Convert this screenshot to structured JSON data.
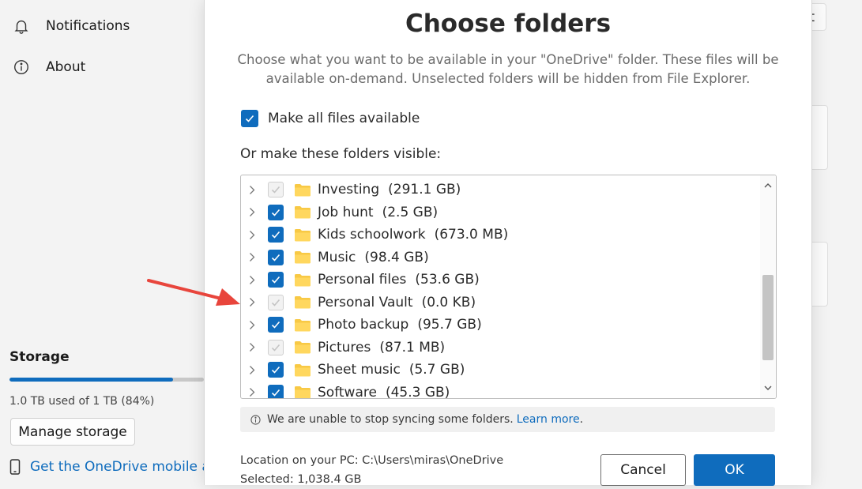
{
  "sidebar": {
    "items": [
      {
        "label": "Notifications",
        "icon": "bell-icon"
      },
      {
        "label": "About",
        "icon": "info-icon"
      }
    ],
    "storage": {
      "title": "Storage",
      "used_fraction": 0.84,
      "usage_text": "1.0 TB used of 1 TB (84%)",
      "manage_label": "Manage storage",
      "mobile_link": "Get the OneDrive mobile ap"
    },
    "partial_button_text": "t"
  },
  "dialog": {
    "title": "Choose folders",
    "description": "Choose what you want to be available in your \"OneDrive\" folder. These files will be available on-demand. Unselected folders will be hidden from File Explorer.",
    "make_all_label": "Make all files available",
    "make_all_checked": true,
    "folders_label": "Or make these folders visible:",
    "folders": [
      {
        "name": "Investing",
        "size": "(291.1 GB)",
        "state": "disabled"
      },
      {
        "name": "Job hunt",
        "size": "(2.5 GB)",
        "state": "checked"
      },
      {
        "name": "Kids schoolwork",
        "size": "(673.0 MB)",
        "state": "checked"
      },
      {
        "name": "Music",
        "size": "(98.4 GB)",
        "state": "checked"
      },
      {
        "name": "Personal files",
        "size": "(53.6 GB)",
        "state": "checked"
      },
      {
        "name": "Personal Vault",
        "size": "(0.0 KB)",
        "state": "disabled"
      },
      {
        "name": "Photo backup",
        "size": "(95.7 GB)",
        "state": "checked"
      },
      {
        "name": "Pictures",
        "size": "(87.1 MB)",
        "state": "disabled"
      },
      {
        "name": "Sheet music",
        "size": "(5.7 GB)",
        "state": "checked"
      },
      {
        "name": "Software",
        "size": "(45.3 GB)",
        "state": "checked"
      }
    ],
    "info_text": "We are unable to stop syncing some folders.",
    "info_link": "Learn more",
    "info_period": ".",
    "location": "Location on your PC: C:\\Users\\miras\\OneDrive",
    "selected": "Selected: 1,038.4 GB",
    "cancel_label": "Cancel",
    "ok_label": "OK"
  },
  "colors": {
    "accent": "#0f6cbd",
    "annotation_arrow": "#e8453c",
    "folder": "#f8c945"
  }
}
